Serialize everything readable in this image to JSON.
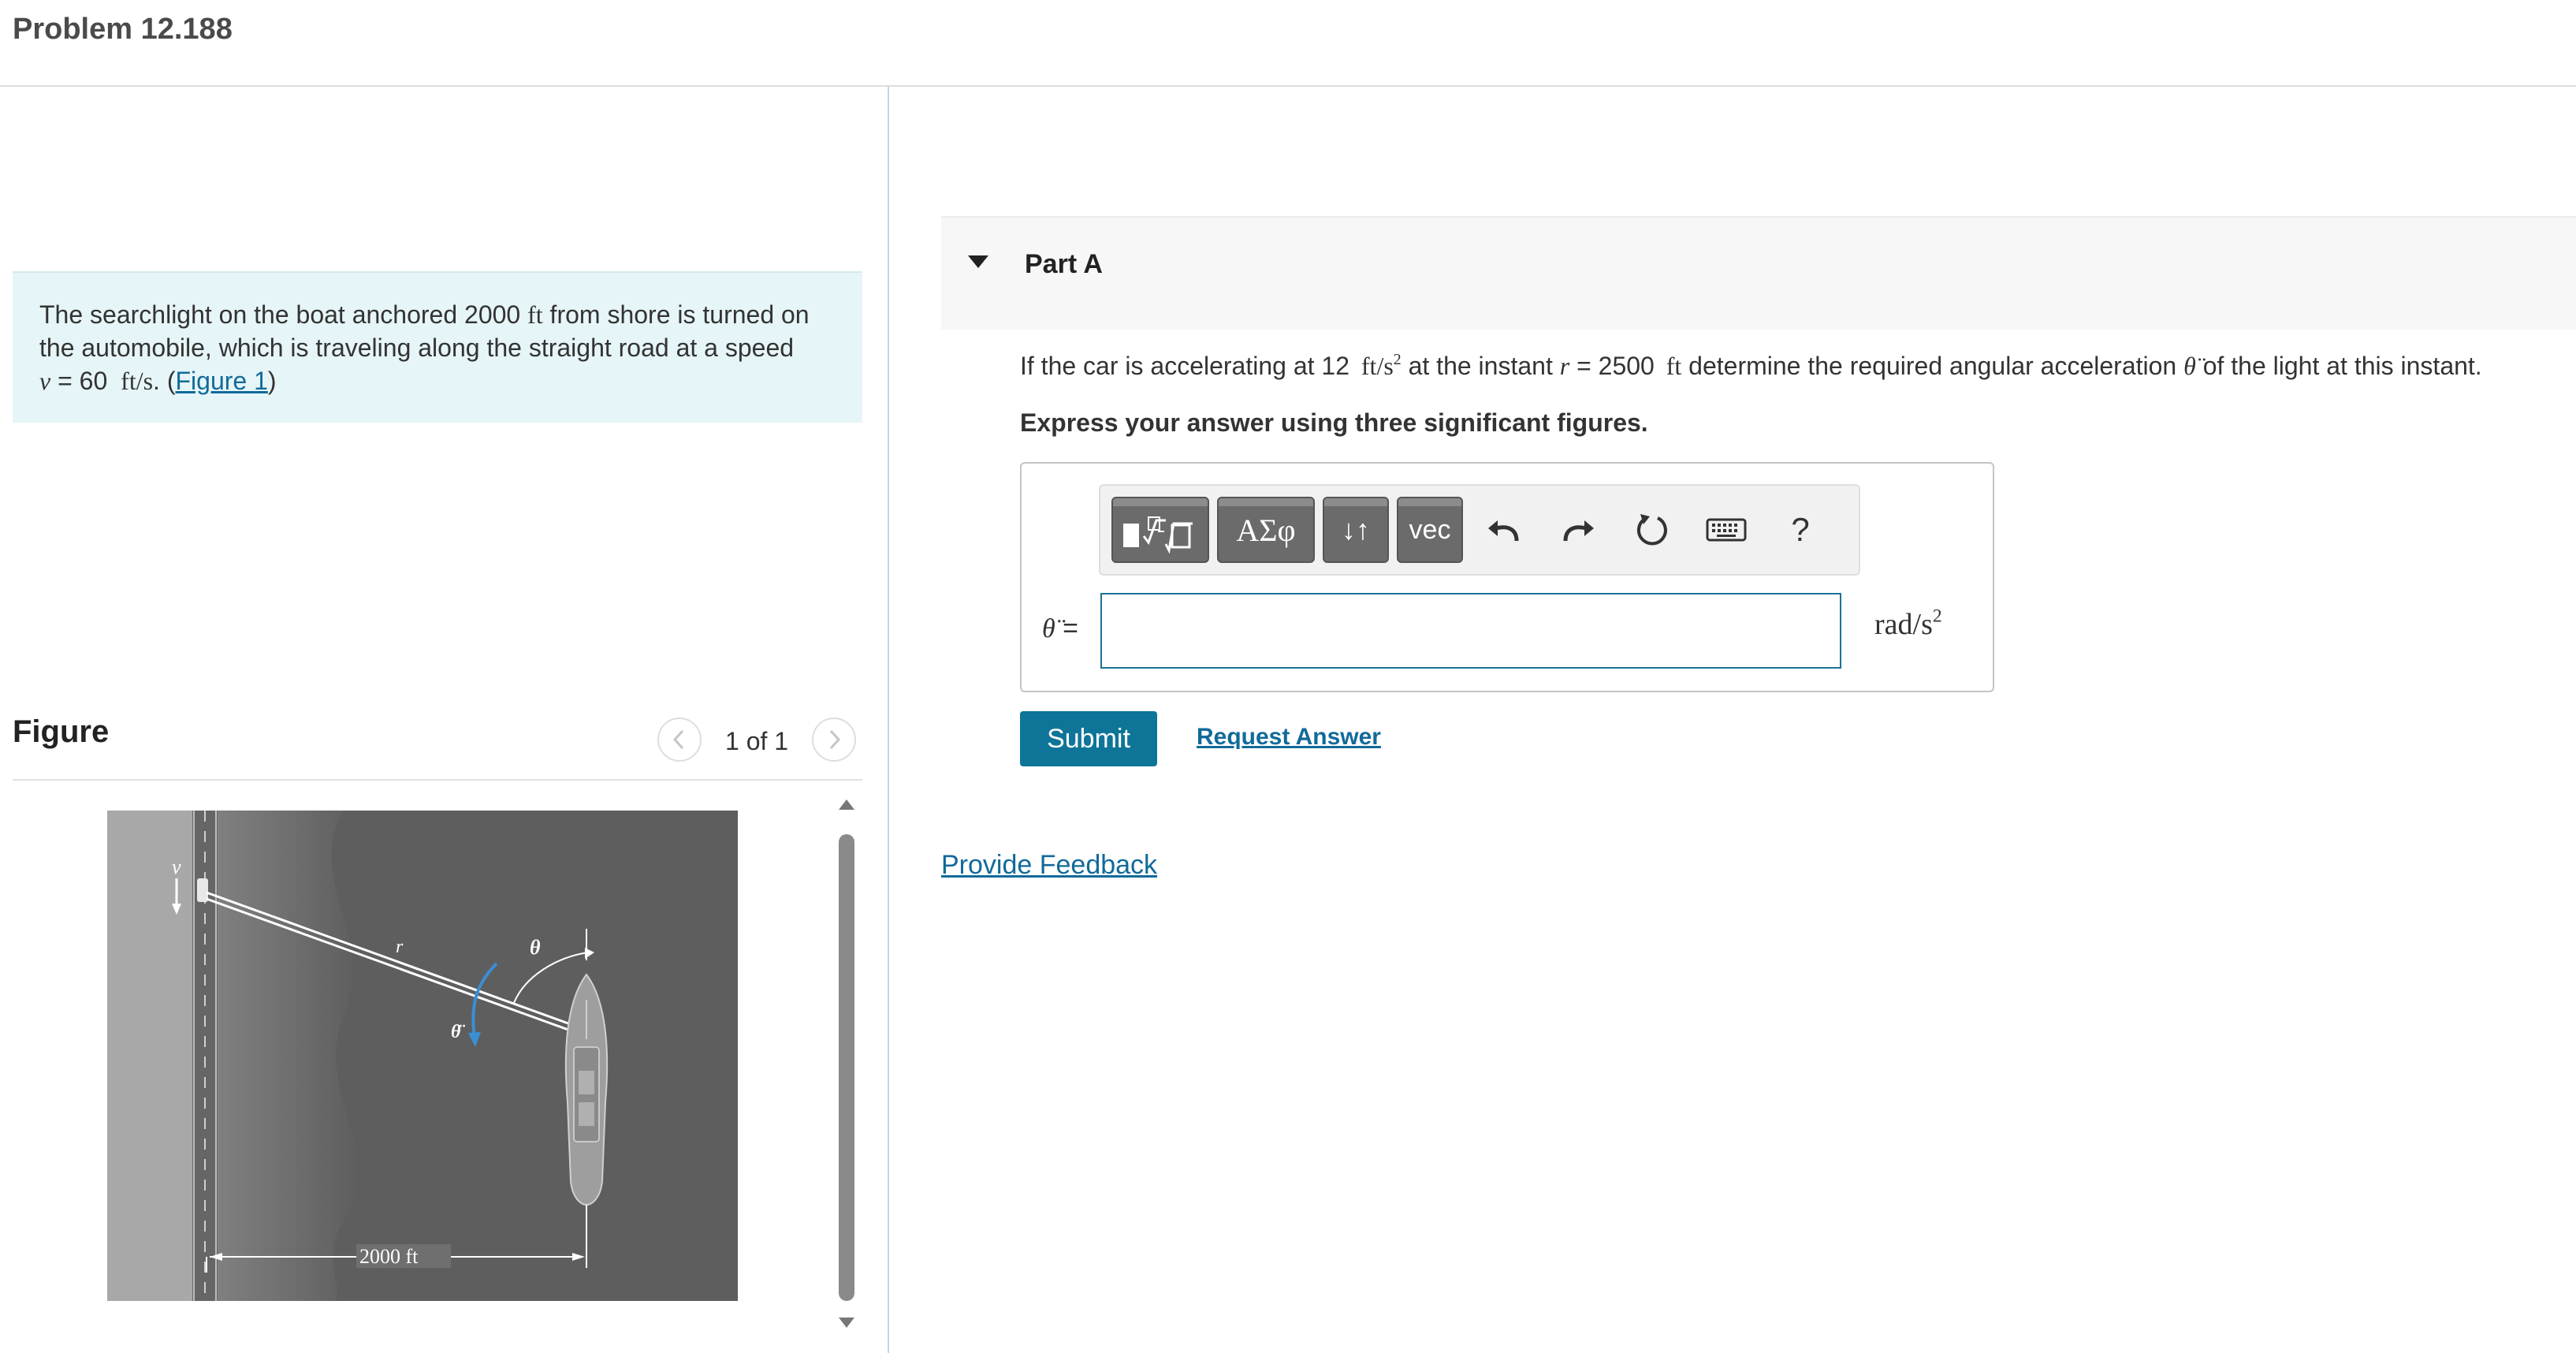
{
  "header": {
    "title": "Problem 12.188"
  },
  "statement": {
    "line1_a": "The searchlight on the boat anchored 2000",
    "line1_unit": "ft",
    "line1_b": "from shore is turned on",
    "line2": "the automobile, which is traveling along the straight road at a speed",
    "v_symbol": "v",
    "v_eq": "= 60",
    "v_unit": "ft/s",
    "dot_open": ". (",
    "figure_link": "Figure 1",
    "close_paren": ")"
  },
  "figure": {
    "label": "Figure",
    "counter": "1 of 1",
    "labels": {
      "v": "v",
      "r": "r",
      "theta": "θ",
      "theta_ddot": "θ̈",
      "distance": "2000 ft"
    }
  },
  "partA": {
    "label": "Part A",
    "question": {
      "a": "If the car is accelerating at 12",
      "accel_unit": "ft/s",
      "accel_exp": "2",
      "b": "at the instant",
      "r_symbol": "r",
      "r_eq": "= 2500",
      "r_unit": "ft",
      "c": "determine the required angular acceleration",
      "theta_symbol": "θ̈",
      "d": "of the light at this instant."
    },
    "instruction": "Express your answer using three significant figures.",
    "toolbar": {
      "greek_label": "ΑΣφ",
      "updown_label": "↓↑",
      "vec_label": "vec",
      "help_label": "?"
    },
    "variable_label": "θ̈",
    "equals": "=",
    "answer_value": "",
    "units": {
      "base": "rad/s",
      "exp": "2"
    },
    "submit_label": "Submit",
    "request_answer_label": "Request Answer"
  },
  "feedback_label": "Provide Feedback",
  "colors": {
    "accent": "#0e7599",
    "link": "#116a9a",
    "statement_bg": "#e6f5f7",
    "figure_arrow": "#3a8fd6"
  }
}
